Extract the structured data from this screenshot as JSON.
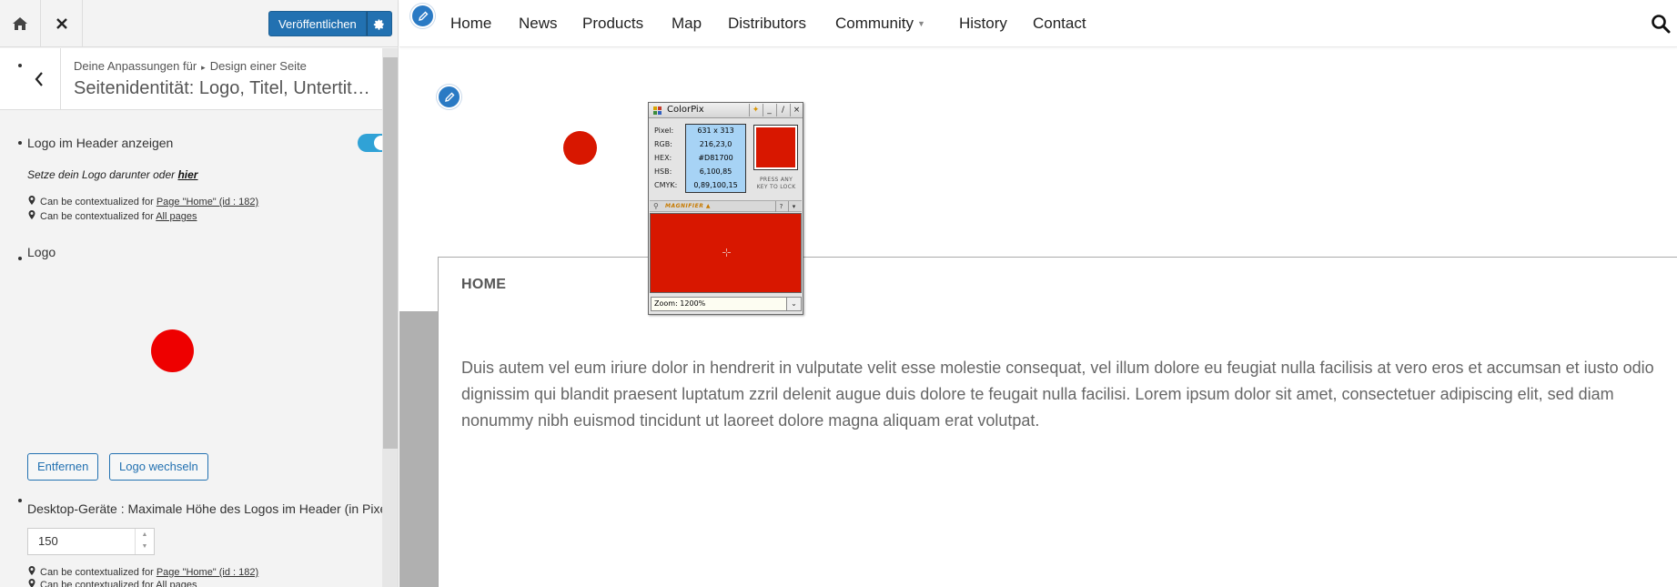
{
  "customizer": {
    "publish_label": "Veröffentlichen",
    "breadcrumb": {
      "prefix": "Deine Anpassungen für",
      "section": "Design einer Seite"
    },
    "section_title": "Seitenidentität: Logo, Titel, Untertitel ...",
    "controls": {
      "show_logo_label": "Logo im Header anzeigen",
      "show_logo_enabled": true,
      "hint_text": "Setze dein Logo darunter oder",
      "hint_link": "hier",
      "ctx_prefix": "Can be contextualized for",
      "ctx_page": "Page \"Home\" (id : 182)",
      "ctx_all": "All pages",
      "logo_label": "Logo",
      "remove_button": "Entfernen",
      "change_logo_button": "Logo wechseln",
      "max_height_label": "Desktop-Geräte : Maximale Höhe des Logos im Header (in Pixel",
      "max_height_value": "150"
    }
  },
  "site": {
    "nav": {
      "items": [
        "Home",
        "News",
        "Products",
        "Map",
        "Distributors",
        "Community",
        "History",
        "Contact"
      ]
    },
    "page_heading": "HOME",
    "body_text": "Duis autem vel eum iriure dolor in hendrerit in vulputate velit esse molestie consequat, vel illum dolore eu feugiat nulla facilisis at vero eros et accumsan et iusto odio dignissim qui blandit praesent luptatum zzril delenit augue duis dolore te feugait nulla facilisi. Lorem ipsum dolor sit amet, consectetuer adipiscing elit, sed diam nonummy nibh euismod tincidunt ut laoreet dolore magna aliquam erat volutpat."
  },
  "colorpix": {
    "title": "ColorPix",
    "labels": {
      "pixel": "Pixel:",
      "rgb": "RGB:",
      "hex": "HEX:",
      "hsb": "HSB:",
      "cmyk": "CMYK:"
    },
    "values": {
      "pixel": "631 x 313",
      "rgb": "216,23,0",
      "hex": "#D81700",
      "hsb": "6,100,85",
      "cmyk": "0,89,100,15"
    },
    "press_hint_line1": "PRESS ANY",
    "press_hint_line2": "KEY TO LOCK",
    "magnifier_label": "MAGNIFIER ▲",
    "help_button": "?",
    "zoom_label": "Zoom: 1200%",
    "picked_color": "#D81700"
  },
  "colors": {
    "accent": "#2271b1",
    "toggle_on": "#30a2d6",
    "logo_red": "#ee0000",
    "picked_red": "#d81700",
    "edit_pencil": "#2a7ac4"
  }
}
